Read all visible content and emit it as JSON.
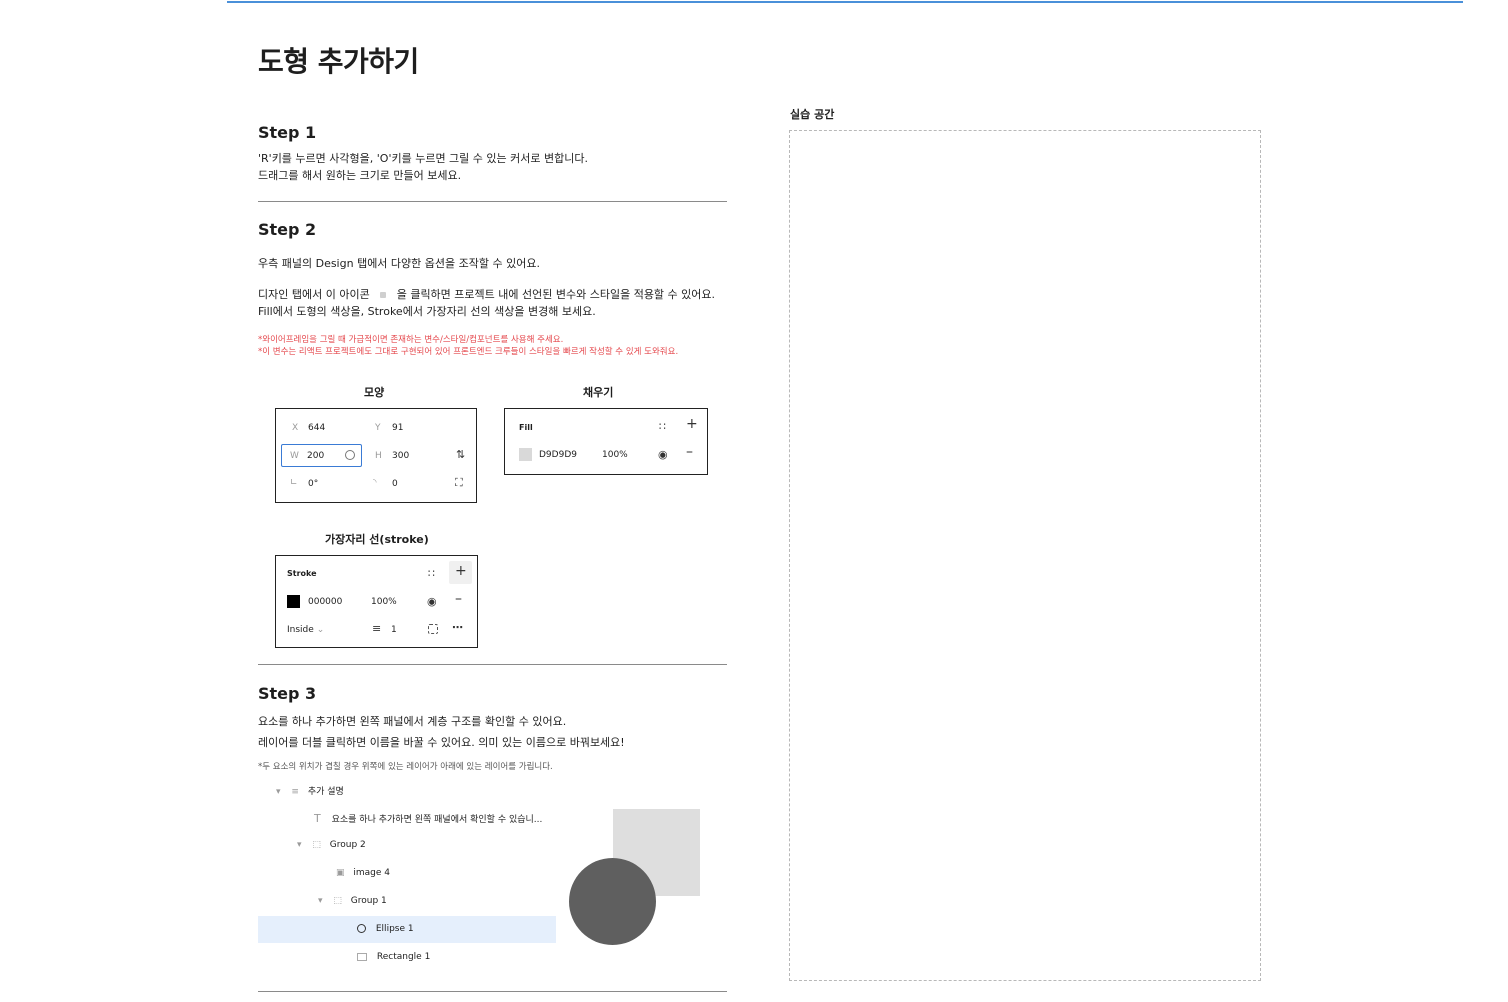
{
  "title": "도형 추가하기",
  "practice_label": "실습 공간",
  "step1": {
    "heading": "Step 1",
    "line1": "'R'키를 누르면 사각형을, 'O'키를 누르면 그릴 수 있는 커서로 변합니다.",
    "line2": "드래그를 해서 원하는 크기로 만들어 보세요."
  },
  "step2": {
    "heading": "Step 2",
    "line1": "우측 패널의 Design 탭에서 다양한 옵션을 조작할 수 있어요.",
    "line2a": "디자인 탭에서 이 아이콘",
    "line2b": "을 클릭하면 프로젝트 내에 선언된 변수와 스타일을 적용할 수 있어요.",
    "line3": "Fill에서 도형의 색상을, Stroke에서 가장자리 선의 색상을 변경해 보세요.",
    "red1": "*와이어프레임을 그릴 때 가급적이면 존재하는 변수/스타일/컴포넌트를 사용해 주세요.",
    "red2": "*이 변수는 리액트 프로젝트에도 그대로 구현되어 있어 프론트엔드 크루들이 스타일을 빠르게 작성할 수 있게 도와줘요."
  },
  "shape_panel": {
    "label": "모양",
    "x_label": "X",
    "x": "644",
    "y_label": "Y",
    "y": "91",
    "w_label": "W",
    "w": "200",
    "h_label": "H",
    "h": "300",
    "rotation": "0°",
    "radius": "0"
  },
  "fill_panel": {
    "label": "채우기",
    "title": "Fill",
    "hex": "D9D9D9",
    "opacity": "100%",
    "swatch_color": "#D9D9D9"
  },
  "stroke_panel": {
    "label": "가장자리 선(stroke)",
    "title": "Stroke",
    "hex": "000000",
    "opacity": "100%",
    "position": "Inside",
    "weight": "1",
    "swatch_color": "#000000"
  },
  "step3": {
    "heading": "Step 3",
    "line1": "요소를 하나 추가하면 왼쪽 패널에서 계층 구조를 확인할 수 있어요.",
    "line2": "레이어를 더블 클릭하면 이름을 바꿀 수 있어요. 의미 있는 이름으로 바꿔보세요!",
    "note": "*두 요소의 위치가 겹칠 경우 위쪽에 있는 레이어가 아래에 있는 레이어를 가립니다."
  },
  "layers": [
    {
      "name": "추가 설명"
    },
    {
      "name": "요소를 하나 추가하면 왼쪽 패널에서 확인할 수 있습니..."
    },
    {
      "name": "Group 2"
    },
    {
      "name": "image 4"
    },
    {
      "name": "Group 1"
    },
    {
      "name": "Ellipse 1"
    },
    {
      "name": "Rectangle 1"
    }
  ],
  "preview": {
    "rect_color": "#DEDEDE",
    "ellipse_color": "#5F5F5F"
  }
}
